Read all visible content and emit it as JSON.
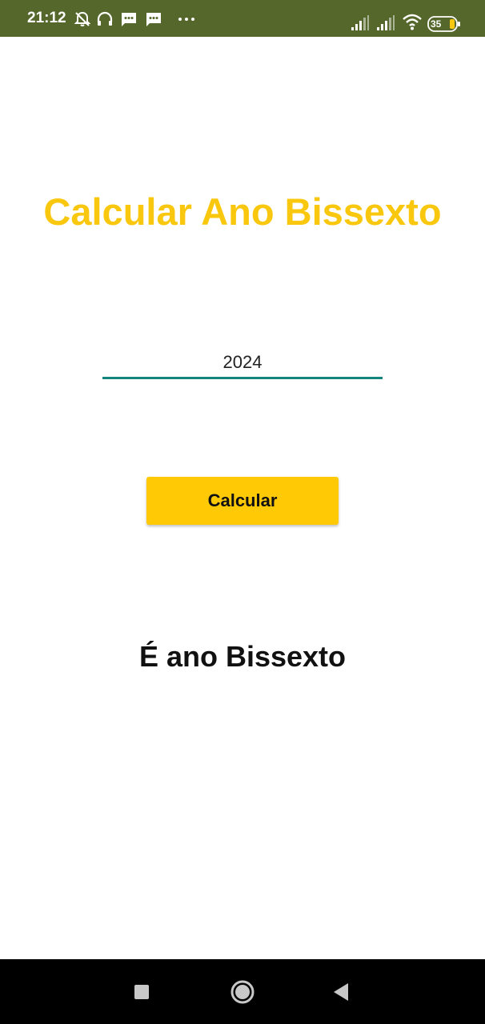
{
  "status_bar": {
    "time": "21:12",
    "battery_percent": "35",
    "icons": [
      "notifications-off-icon",
      "headset-icon",
      "message-icon",
      "message-icon",
      "more-icon",
      "signal-icon",
      "signal-icon",
      "wifi-icon",
      "battery-icon"
    ],
    "background_color": "#55672a"
  },
  "app": {
    "title": "Calcular Ano Bissexto",
    "title_color": "#f9c80e",
    "year_input": {
      "value": "2024",
      "underline_color": "#13857e"
    },
    "calculate_button": {
      "label": "Calcular",
      "color": "#ffca05"
    },
    "result_text": "É ano Bissexto"
  },
  "nav_bar": {
    "buttons": [
      "recent-apps-icon",
      "home-icon",
      "back-icon"
    ]
  }
}
